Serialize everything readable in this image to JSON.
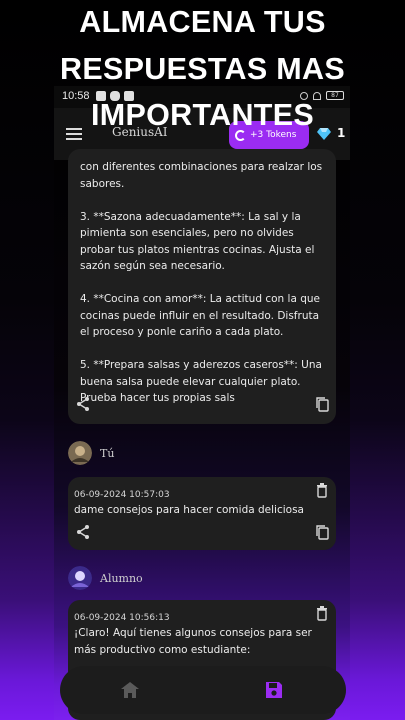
{
  "promo": {
    "line1": "ALMACENA TUS",
    "line2": "RESPUESTAS MAS",
    "line3": "IMPORTANTES"
  },
  "status_bar": {
    "time": "10:58",
    "battery": "87"
  },
  "app_bar": {
    "title": "GeniusAI",
    "tokens_label": "+3 Tokens",
    "gem_count": "1"
  },
  "messages": [
    {
      "text": "con diferentes combinaciones para realzar los sabores.\n\n3. **Sazona adecuadamente**: La sal y la pimienta son esenciales, pero no olvides probar tus platos mientras cocinas. Ajusta el sazón según sea necesario.\n\n4. **Cocina con amor**: La actitud con la que cocinas puede influir en el resultado. Disfruta el proceso y ponle cariño a cada plato.\n\n5. **Prepara salsas y aderezos caseros**: Una buena salsa puede elevar cualquier plato. Prueba hacer tus propias sals"
    },
    {
      "author": "Tú",
      "date": "06-09-2024 10:57:03",
      "text": "dame consejos para hacer comida deliciosa"
    },
    {
      "author": "Alumno",
      "date": "06-09-2024 10:56:13",
      "text": "¡Claro! Aquí tienes algunos consejos para ser más productivo como estudiante:"
    }
  ],
  "icons": {
    "share": "share-icon",
    "copy": "copy-icon",
    "delete": "trash-icon",
    "home": "home-icon",
    "saved": "save-icon"
  },
  "colors": {
    "accent": "#9b2cf2",
    "gradient_bottom": "#7b1cf0",
    "card_bg": "#1f1f1f",
    "saved_icon": "#9b2cf2"
  }
}
